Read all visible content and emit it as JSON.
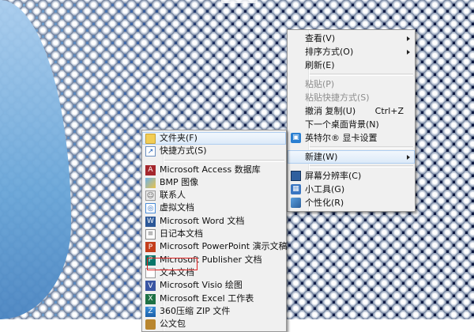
{
  "desktop": {
    "wallpaper": "perforated metal spheres",
    "accent": "#13204d"
  },
  "main_menu": {
    "items": [
      {
        "label": "查看(V)",
        "submenu": true
      },
      {
        "label": "排序方式(O)",
        "submenu": true
      },
      {
        "label": "刷新(E)"
      },
      {
        "separator": true
      },
      {
        "label": "粘贴(P)",
        "disabled": true
      },
      {
        "label": "粘贴快捷方式(S)",
        "disabled": true
      },
      {
        "label": "撤消 复制(U)",
        "shortcut": "Ctrl+Z"
      },
      {
        "label": "下一个桌面背景(N)"
      },
      {
        "label": "英特尔® 显卡设置",
        "icon": "intel-graphics-icon"
      },
      {
        "separator": true
      },
      {
        "label": "新建(W)",
        "submenu": true,
        "highlighted": true
      },
      {
        "separator": true
      },
      {
        "label": "屏幕分辨率(C)",
        "icon": "monitor-icon"
      },
      {
        "label": "小工具(G)",
        "icon": "gadgets-icon"
      },
      {
        "label": "个性化(R)",
        "icon": "personalize-icon"
      }
    ]
  },
  "new_submenu": {
    "items": [
      {
        "label": "文件夹(F)",
        "icon": "folder-icon",
        "highlighted": true
      },
      {
        "label": "快捷方式(S)",
        "icon": "shortcut-icon"
      },
      {
        "separator": true
      },
      {
        "label": "Microsoft Access 数据库",
        "icon": "access-icon"
      },
      {
        "label": "BMP 图像",
        "icon": "bmp-icon"
      },
      {
        "label": "联系人",
        "icon": "contact-icon"
      },
      {
        "label": "虚拟文档",
        "icon": "virtual-doc-icon"
      },
      {
        "label": "Microsoft Word 文档",
        "icon": "word-icon"
      },
      {
        "label": "日记本文档",
        "icon": "journal-icon"
      },
      {
        "label": "Microsoft PowerPoint 演示文稿",
        "icon": "powerpoint-icon"
      },
      {
        "label": "Microsoft Publisher 文档",
        "icon": "publisher-icon"
      },
      {
        "label": "文本文档",
        "icon": "text-doc-icon",
        "boxed": true
      },
      {
        "label": "Microsoft Visio 绘图",
        "icon": "visio-icon"
      },
      {
        "label": "Microsoft Excel 工作表",
        "icon": "excel-icon"
      },
      {
        "label": "360压缩 ZIP 文件",
        "icon": "zip-icon"
      },
      {
        "label": "公文包",
        "icon": "briefcase-icon"
      }
    ]
  }
}
